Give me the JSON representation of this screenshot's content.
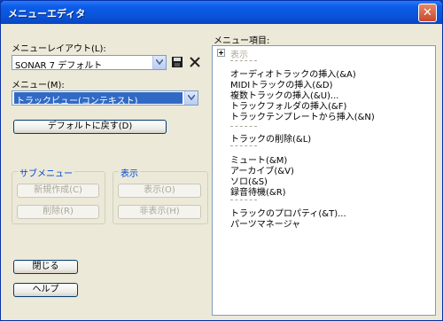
{
  "window": {
    "title": "メニューエディタ",
    "close_glyph": "✕"
  },
  "left": {
    "layout_label": "メニューレイアウト(L):",
    "layout_value": "SONAR 7 デフォルト",
    "menu_label": "メニュー(M):",
    "menu_value": "トラックビュー(コンテキスト)",
    "reset_label": "デフォルトに戻す(D)",
    "submenu_group_title": "サブメニュー",
    "new_label": "新規作成(C)",
    "delete_label": "削除(R)",
    "display_group_title": "表示",
    "show_label": "表示(O)",
    "hide_label": "非表示(H)",
    "close_label": "閉じる",
    "help_label": "ヘルプ"
  },
  "items_panel": {
    "label": "メニュー項目:",
    "items": [
      {
        "kind": "folder",
        "text": "表示"
      },
      {
        "kind": "sep"
      },
      {
        "kind": "item",
        "text": "オーディオトラックの挿入(&A)"
      },
      {
        "kind": "item",
        "text": "MIDIトラックの挿入(&D)"
      },
      {
        "kind": "item",
        "text": "複数トラックの挿入(&U)..."
      },
      {
        "kind": "item",
        "text": "トラックフォルダの挿入(&F)"
      },
      {
        "kind": "item",
        "text": "トラックテンプレートから挿入(&N)"
      },
      {
        "kind": "sep"
      },
      {
        "kind": "item",
        "text": "トラックの削除(&L)"
      },
      {
        "kind": "sep"
      },
      {
        "kind": "item",
        "text": "ミュート(&M)"
      },
      {
        "kind": "item",
        "text": "アーカイブ(&V)"
      },
      {
        "kind": "item",
        "text": "ソロ(&S)"
      },
      {
        "kind": "item",
        "text": "録音待機(&R)"
      },
      {
        "kind": "sep"
      },
      {
        "kind": "item",
        "text": "トラックのプロパティ(&T)..."
      },
      {
        "kind": "item",
        "text": "パーツマネージャ"
      }
    ]
  },
  "icons": {
    "save": "save-icon",
    "delete": "delete-x-icon",
    "dropdown": "chevron-down-icon",
    "expand": "plus-expand-icon"
  }
}
